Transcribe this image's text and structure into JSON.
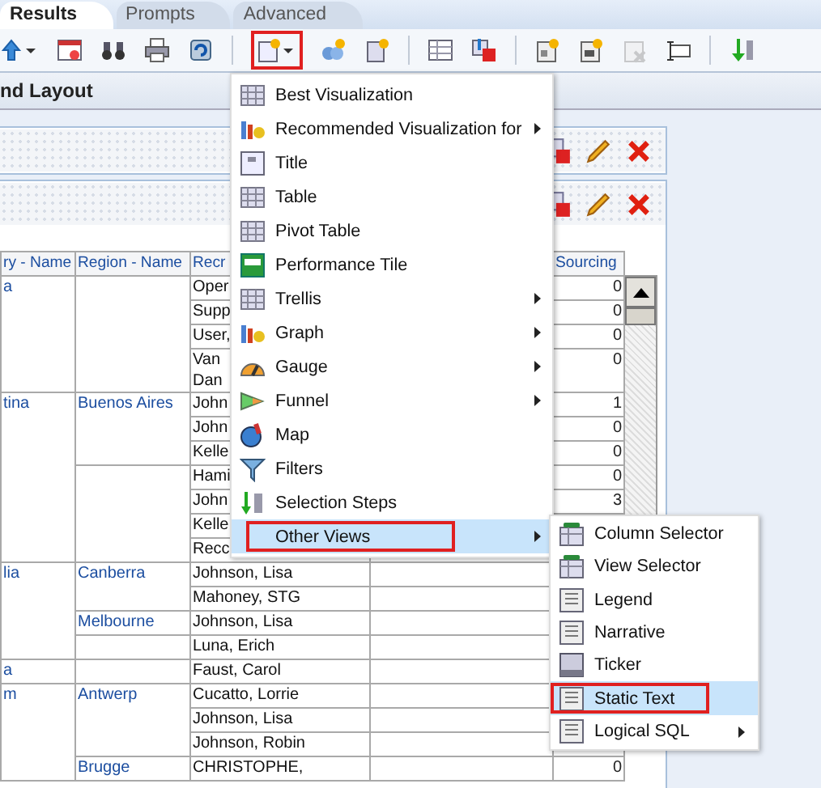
{
  "tabs": [
    {
      "label": "Results",
      "selected": true
    },
    {
      "label": "Prompts",
      "selected": false
    },
    {
      "label": "Advanced",
      "selected": false
    }
  ],
  "toolbar": {
    "new_view_button_outlined": true
  },
  "section_title": "nd Layout",
  "table": {
    "columns": [
      "ry - Name",
      "Region - Name",
      "Recr",
      "Sourcing"
    ],
    "countries": [
      {
        "name": "a",
        "regions": [
          {
            "recruiters": [
              {
                "name": "Oper",
                "sourcing": "0"
              },
              {
                "name": "Supp",
                "sourcing": "0"
              },
              {
                "name": "User,",
                "sourcing": "0"
              },
              {
                "name": "Van\nDan",
                "sourcing": "0"
              }
            ]
          }
        ]
      },
      {
        "name": "tina",
        "regions": [
          {
            "name": "Buenos Aires",
            "recruiters": [
              {
                "name": "John",
                "sourcing": "1"
              },
              {
                "name": "John",
                "sourcing": "0"
              },
              {
                "name": "Kelle",
                "sourcing": "0"
              }
            ]
          },
          {
            "recruiters": [
              {
                "name": "Hami",
                "sourcing": "0"
              },
              {
                "name": "John",
                "sourcing": "3"
              },
              {
                "name": "Kelle"
              },
              {
                "name": "Recc"
              }
            ]
          }
        ]
      },
      {
        "name": "lia",
        "regions": [
          {
            "name": "Canberra",
            "recruiters": [
              {
                "name": "Johnson, Lisa"
              },
              {
                "name": "Mahoney, STG"
              }
            ]
          },
          {
            "name": "Melbourne",
            "recruiters": [
              {
                "name": "Johnson, Lisa"
              }
            ]
          },
          {
            "recruiters": [
              {
                "name": "Luna, Erich"
              }
            ]
          }
        ]
      },
      {
        "name": "a",
        "regions": [
          {
            "recruiters": [
              {
                "name": "Faust, Carol"
              }
            ]
          }
        ]
      },
      {
        "name": "m",
        "regions": [
          {
            "name": "Antwerp",
            "recruiters": [
              {
                "name": "Cucatto, Lorrie"
              },
              {
                "name": "Johnson, Lisa"
              },
              {
                "name": "Johnson, Robin"
              }
            ]
          },
          {
            "name": "Brugge",
            "recruiters": [
              {
                "name": "CHRISTOPHE,",
                "sourcing": "0"
              }
            ]
          }
        ]
      }
    ]
  },
  "menu": {
    "items": [
      {
        "label": "Best Visualization",
        "submenu": false,
        "selected": false,
        "outlined": false
      },
      {
        "label": "Recommended Visualization for",
        "submenu": true,
        "selected": false,
        "outlined": false
      },
      {
        "label": "Title",
        "submenu": false,
        "selected": false,
        "outlined": false
      },
      {
        "label": "Table",
        "submenu": false,
        "selected": false,
        "outlined": false
      },
      {
        "label": "Pivot Table",
        "submenu": false,
        "selected": false,
        "outlined": false
      },
      {
        "label": "Performance Tile",
        "submenu": false,
        "selected": false,
        "outlined": false
      },
      {
        "label": "Trellis",
        "submenu": true,
        "selected": false,
        "outlined": false
      },
      {
        "label": "Graph",
        "submenu": true,
        "selected": false,
        "outlined": false
      },
      {
        "label": "Gauge",
        "submenu": true,
        "selected": false,
        "outlined": false
      },
      {
        "label": "Funnel",
        "submenu": true,
        "selected": false,
        "outlined": false
      },
      {
        "label": "Map",
        "submenu": false,
        "selected": false,
        "outlined": false
      },
      {
        "label": "Filters",
        "submenu": false,
        "selected": false,
        "outlined": false
      },
      {
        "label": "Selection Steps",
        "submenu": false,
        "selected": false,
        "outlined": false
      },
      {
        "label": "Other Views",
        "submenu": true,
        "selected": true,
        "outlined": true
      }
    ]
  },
  "submenu": {
    "items": [
      {
        "label": "Column Selector",
        "submenu": false,
        "selected": false,
        "outlined": false
      },
      {
        "label": "View Selector",
        "submenu": false,
        "selected": false,
        "outlined": false
      },
      {
        "label": "Legend",
        "submenu": false,
        "selected": false,
        "outlined": false
      },
      {
        "label": "Narrative",
        "submenu": false,
        "selected": false,
        "outlined": false
      },
      {
        "label": "Ticker",
        "submenu": false,
        "selected": false,
        "outlined": false
      },
      {
        "label": "Static Text",
        "submenu": false,
        "selected": true,
        "outlined": true
      },
      {
        "label": "Logical SQL",
        "submenu": true,
        "selected": false,
        "outlined": false
      }
    ]
  }
}
